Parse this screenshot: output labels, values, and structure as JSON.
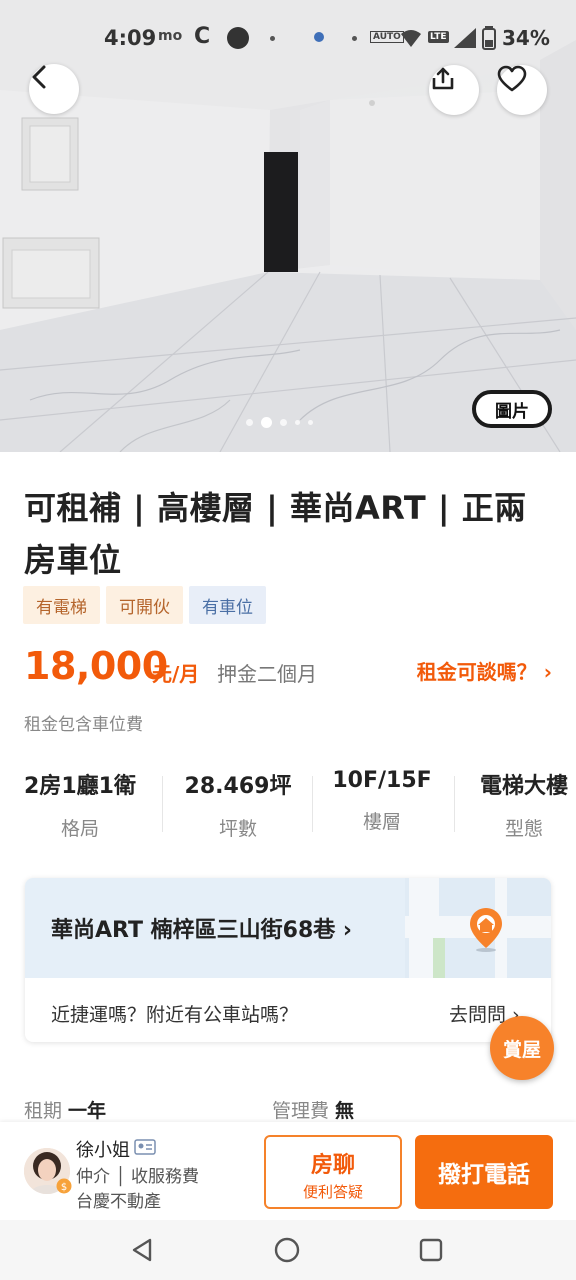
{
  "status_bar": {
    "time": "4:09",
    "battery": "34%",
    "small_a": "mo",
    "small_b": "AUTO",
    "small_c": "LTE"
  },
  "hero": {
    "photo_button_label": "圖片",
    "page_count": 5,
    "active_page": 2
  },
  "listing": {
    "title": "可租補 | 高樓層 | 華尚ART | 正兩房車位",
    "tags": [
      {
        "label": "有電梯",
        "style": "warm"
      },
      {
        "label": "可開伙",
        "style": "warm"
      },
      {
        "label": "有車位",
        "style": "cool"
      }
    ],
    "price": "18,000",
    "price_unit": "元/月",
    "deposit": "押金二個月",
    "negotiate": "租金可談嗎？ ›",
    "rent_note": "租金包含車位費",
    "specs": [
      {
        "value": "2房1廳1衛",
        "label": "格局"
      },
      {
        "value": "28.469坪",
        "label": "坪數"
      },
      {
        "value": "10F/15F",
        "label": "樓層"
      },
      {
        "value": "電梯大樓",
        "label": "型態"
      }
    ]
  },
  "address_card": {
    "address": "華尚ART 楠梓區三山街68巷 ›",
    "question": "近捷運嗎？附近有公車站嗎？",
    "ask_label": "去問問 ›"
  },
  "fab_label": "賞屋",
  "info": {
    "lease_label": "租期",
    "lease_value": "一年",
    "mgmt_label": "管理費",
    "mgmt_value": "無"
  },
  "agent": {
    "name": "徐小姐",
    "role": "仲介 │ 收服務費",
    "company": "台慶不動產"
  },
  "actions": {
    "chat_title": "房聊",
    "chat_sub": "便利答疑",
    "call": "撥打電話"
  },
  "colors": {
    "accent": "#f25a0a",
    "tag_warm_bg": "#fdf0e1",
    "tag_cool_bg": "#e8eef8"
  }
}
